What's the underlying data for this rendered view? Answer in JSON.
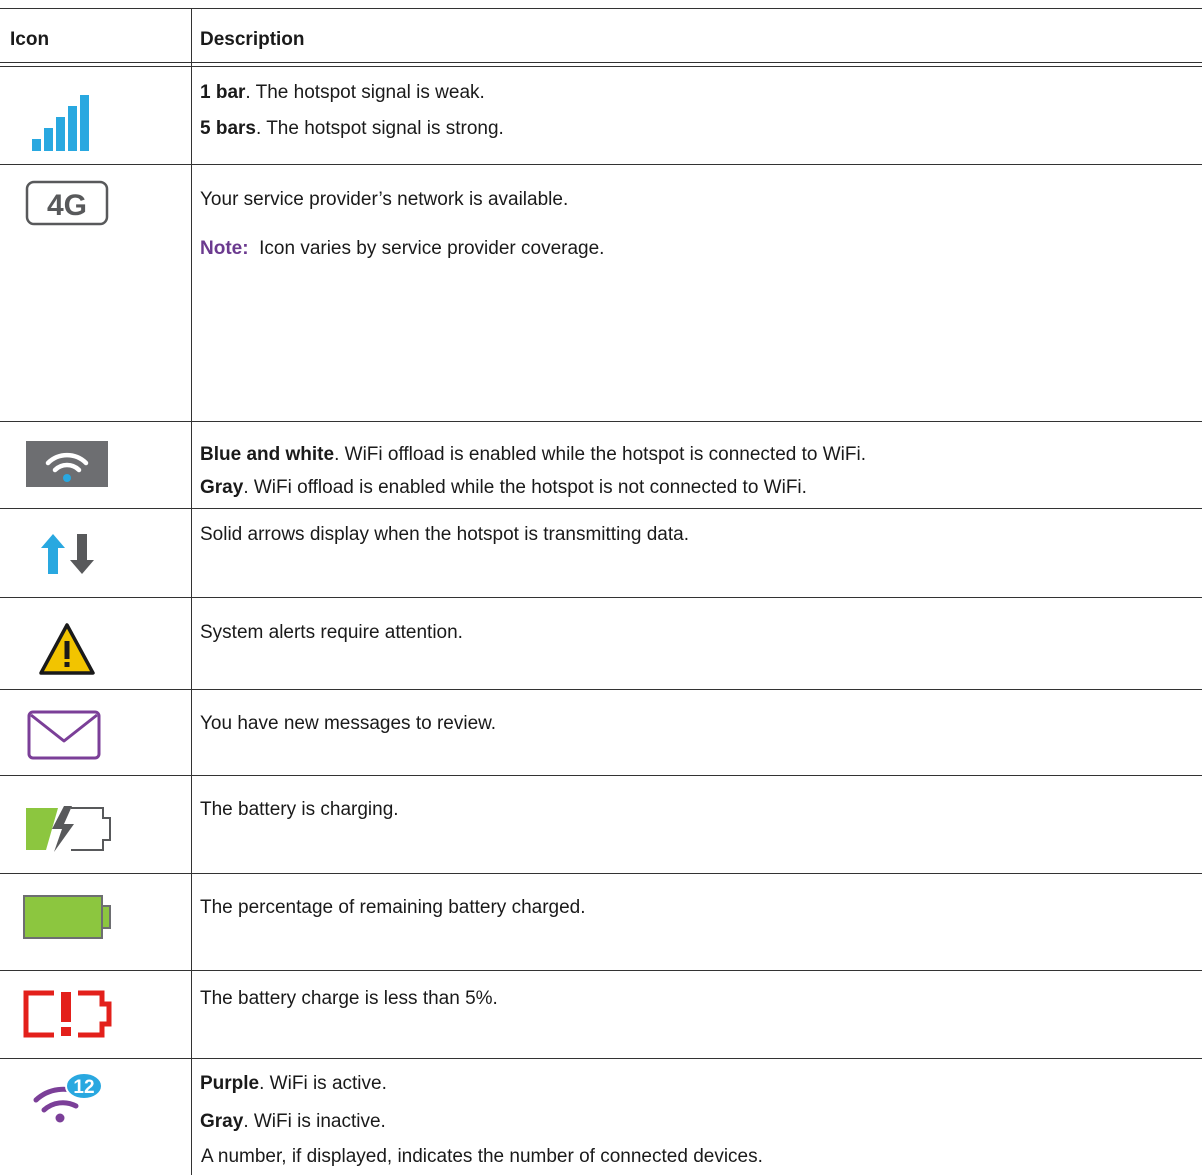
{
  "header": {
    "icon_col": "Icon",
    "desc_col": "Description"
  },
  "rows": [
    {
      "icon": "signal-bars-icon",
      "lines": [
        {
          "bold": "1 bar",
          "text": ". The hotspot signal is weak."
        },
        {
          "bold": "5 bars",
          "text": ". The hotspot signal is strong."
        }
      ]
    },
    {
      "icon": "4g-network-icon",
      "icon_text": "4G",
      "lines": [
        {
          "text": "Your service provider’s network is available."
        }
      ],
      "note": {
        "label": "Note:",
        "text": "Icon varies by service provider coverage."
      }
    },
    {
      "icon": "wifi-offload-icon",
      "lines": [
        {
          "bold": "Blue and white",
          "text": ". WiFi offload is enabled while the hotspot is connected to WiFi."
        },
        {
          "bold": "Gray",
          "text": ". WiFi offload is enabled while the hotspot is not connected to WiFi."
        }
      ]
    },
    {
      "icon": "data-transfer-arrows-icon",
      "lines": [
        {
          "text": "Solid arrows display when the hotspot is transmitting data."
        }
      ]
    },
    {
      "icon": "warning-triangle-icon",
      "lines": [
        {
          "text": "System alerts require attention."
        }
      ]
    },
    {
      "icon": "envelope-icon",
      "lines": [
        {
          "text": "You have new messages to review."
        }
      ]
    },
    {
      "icon": "battery-charging-icon",
      "lines": [
        {
          "text": "The battery is charging."
        }
      ]
    },
    {
      "icon": "battery-full-icon",
      "lines": [
        {
          "text": "The percentage of remaining battery charged."
        }
      ]
    },
    {
      "icon": "battery-low-icon",
      "lines": [
        {
          "text": "The battery charge is less than 5%."
        }
      ]
    },
    {
      "icon": "wifi-devices-icon",
      "badge": "12",
      "lines": [
        {
          "bold": "Purple",
          "text": ". WiFi is active."
        },
        {
          "bold": "Gray",
          "text": ". WiFi is inactive."
        },
        {
          "text": "A number, if displayed, indicates the number of connected devices."
        }
      ]
    }
  ],
  "colors": {
    "signal_blue": "#29a8e0",
    "wifi_box_gray": "#6d6e71",
    "arrow_gray": "#58595b",
    "warning_yellow": "#f2c400",
    "envelope_purple": "#7b3f98",
    "battery_green": "#8cc63f",
    "battery_red": "#e3201b",
    "wifi_purple": "#7b3f98",
    "badge_blue": "#29a8e0",
    "note_purple": "#6b3a8f"
  }
}
